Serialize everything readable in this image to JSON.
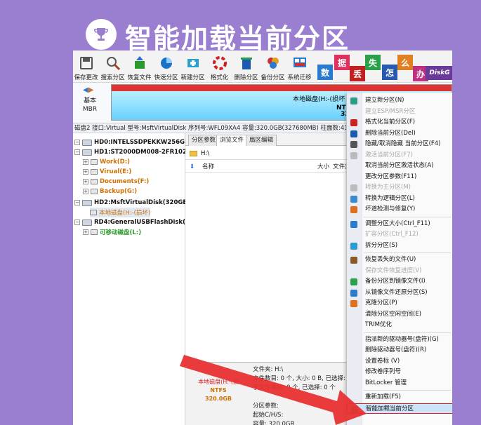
{
  "banner": {
    "title": "智能加载当前分区",
    "icon": "trophy-icon"
  },
  "toolbar": [
    {
      "label": "保存更改",
      "icon": "save-icon",
      "color": "#555"
    },
    {
      "label": "搜索分区",
      "icon": "search-icon",
      "color": "#555"
    },
    {
      "label": "恢复文件",
      "icon": "recover-icon",
      "color": "#2a9a2a"
    },
    {
      "label": "快速分区",
      "icon": "quick-partition-icon",
      "color": "#1a73c8"
    },
    {
      "label": "新建分区",
      "icon": "new-partition-icon",
      "color": "#2aa0d0"
    },
    {
      "label": "格式化",
      "icon": "format-icon",
      "color": "#d02020"
    },
    {
      "label": "删除分区",
      "icon": "delete-icon",
      "color": "#1a5ab0"
    },
    {
      "label": "备份分区",
      "icon": "backup-icon",
      "color": "#e0a020"
    },
    {
      "label": "系统迁移",
      "icon": "migrate-icon",
      "color": "#2a7ad0"
    }
  ],
  "ad": {
    "tiles": [
      "数",
      "据",
      "丢",
      "失",
      "怎",
      "么",
      "办"
    ],
    "brand": "DiskG"
  },
  "disk_bar": {
    "type_line1": "基本",
    "type_line2": "MBR",
    "part_name": "本地磁盘(H:-(损坏",
    "part_fs": "NTFS (活动)",
    "part_size": "320.0GB"
  },
  "info_line": "磁盘2 接口:Virtual  型号:MsftVirtualDisk  序列号:WFL09XA4  容量:320.0GB(327680MB)  柱面数:4177",
  "tree": [
    {
      "text": "HD0:INTELSSDPEKKW256G8(2",
      "kind": "hd"
    },
    {
      "text": "HD1:ST2000DM008-2FR102(18",
      "kind": "hd"
    },
    {
      "text": "Work(D:)",
      "kind": "pt"
    },
    {
      "text": "Virual(E:)",
      "kind": "pt"
    },
    {
      "text": "Documents(F:)",
      "kind": "pt"
    },
    {
      "text": "Backup(G:)",
      "kind": "pt"
    },
    {
      "text": "HD2:MsftVirtualDisk(320GB)",
      "kind": "hd"
    },
    {
      "text": "本地磁盘(H:-(损坏)",
      "kind": "pt-sel"
    },
    {
      "text": "RD4:GeneralUSBFlashDisk(4G",
      "kind": "hd"
    },
    {
      "text": "可移动磁盘(L:)",
      "kind": "pt-green"
    }
  ],
  "tabs": [
    "分区参数",
    "浏览文件",
    "扇区编辑"
  ],
  "path": "H:\\",
  "columns": {
    "name": "名称",
    "size": "大小",
    "type": "文件类"
  },
  "bottom": {
    "mini_name": "本地磁盘(H:-(损",
    "mini_fs": "NTFS",
    "mini_size": "320.0GB",
    "stats": [
      "文件夹: H:\\",
      "文件数目: 0 个, 大小: 0 B, 已选择: 0",
      "子文件夹数: 0 个, 已选择: 0 个",
      "",
      "分区参数:",
      "起始C/H/S:",
      "容量: 320.0GB"
    ]
  },
  "menu": [
    {
      "text": "建立新分区(N)",
      "enabled": true,
      "color": "#2a9a8a"
    },
    {
      "text": "建立ESP/MSR分区",
      "enabled": false,
      "color": ""
    },
    {
      "text": "格式化当前分区(F)",
      "enabled": true,
      "color": "#d02020"
    },
    {
      "text": "删除当前分区(Del)",
      "enabled": true,
      "color": "#1a5ab0"
    },
    {
      "text": "隐藏/取消隐藏 当前分区(F4)",
      "enabled": true,
      "color": "#555"
    },
    {
      "text": "激活当前分区(F7)",
      "enabled": false,
      "color": "#bbb"
    },
    {
      "text": "取消当前分区激活状态(A)",
      "enabled": true,
      "color": ""
    },
    {
      "text": "更改分区参数(F11)",
      "enabled": true,
      "color": ""
    },
    {
      "text": "转换为主分区(M)",
      "enabled": false,
      "color": "#bbb"
    },
    {
      "text": "转换为逻辑分区(L)",
      "enabled": true,
      "color": "#3a8ad0"
    },
    {
      "text": "坏道检测与修复(Y)",
      "enabled": true,
      "color": "#e07020"
    },
    {
      "sep": true
    },
    {
      "text": "调整分区大小(Ctrl_F11)",
      "enabled": true,
      "color": "#2a7ad0"
    },
    {
      "text": "扩容分区(Ctrl_F12)",
      "enabled": false,
      "color": ""
    },
    {
      "text": "拆分分区(S)",
      "enabled": true,
      "color": "#2a9ad0"
    },
    {
      "sep": true
    },
    {
      "text": "恢复丢失的文件(U)",
      "enabled": true,
      "color": "#8a5a2a"
    },
    {
      "text": "保存文件恢复进度(V)",
      "enabled": false,
      "color": ""
    },
    {
      "text": "备份分区到镜像文件(I)",
      "enabled": true,
      "color": "#2aa04a"
    },
    {
      "text": "从镜像文件还原分区(S)",
      "enabled": true,
      "color": "#2a7ad0"
    },
    {
      "text": "克隆分区(P)",
      "enabled": true,
      "color": "#e07020"
    },
    {
      "text": "清除分区空闲空间(E)",
      "enabled": true,
      "color": ""
    },
    {
      "text": "TRIM优化",
      "enabled": true,
      "color": ""
    },
    {
      "sep": true
    },
    {
      "text": "指派新的驱动器号(盘符)(G)",
      "enabled": true,
      "color": ""
    },
    {
      "text": "删除驱动器号(盘符)(R)",
      "enabled": true,
      "color": ""
    },
    {
      "text": "设置卷标 (V)",
      "enabled": true,
      "color": ""
    },
    {
      "text": "修改卷序列号",
      "enabled": true,
      "color": ""
    },
    {
      "text": "BitLocker 管理",
      "enabled": true,
      "color": ""
    },
    {
      "sep": true
    },
    {
      "text": "重新加载(F5)",
      "enabled": true,
      "color": ""
    },
    {
      "text": "智能加载当前分区",
      "enabled": true,
      "color": "#2a9a4a",
      "highlight": true
    }
  ],
  "colors": {
    "background": "#9a7ed0",
    "arrow": "#e83030",
    "partition_top": "#d33"
  }
}
